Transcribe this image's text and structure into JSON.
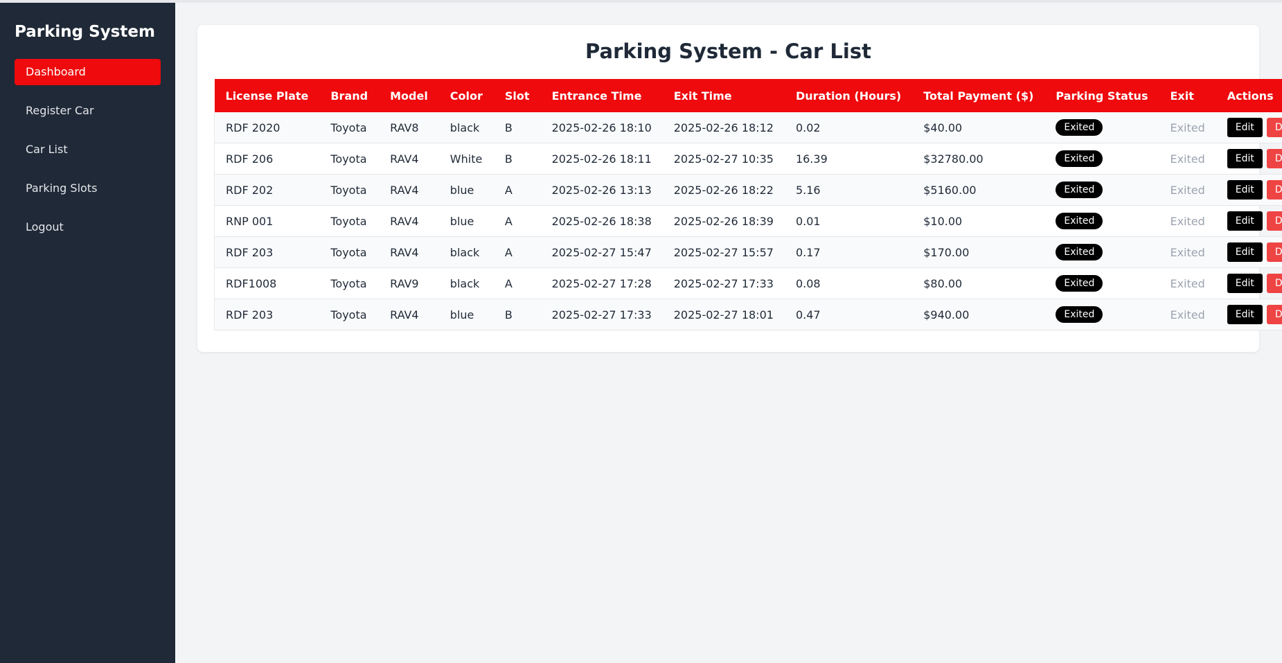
{
  "sidebar": {
    "brand": "Parking System",
    "items": [
      {
        "label": "Dashboard",
        "active": true
      },
      {
        "label": "Register Car"
      },
      {
        "label": "Car List"
      },
      {
        "label": "Parking Slots"
      },
      {
        "label": "Logout"
      }
    ]
  },
  "main": {
    "title": "Parking System - Car List",
    "columns": [
      "License Plate",
      "Brand",
      "Model",
      "Color",
      "Slot",
      "Entrance Time",
      "Exit Time",
      "Duration (Hours)",
      "Total Payment ($)",
      "Parking Status",
      "Exit",
      "Actions"
    ],
    "rows": [
      {
        "plate": "RDF 2020",
        "brand": "Toyota",
        "model": "RAV8",
        "color": "black",
        "slot": "B",
        "entrance": "2025-02-26 18:10",
        "exit_time": "2025-02-26 18:12",
        "duration": "0.02",
        "payment": "$40.00",
        "status": "Exited",
        "exit": "Exited",
        "edit": "Edit",
        "delete": "Delete"
      },
      {
        "plate": "RDF 206",
        "brand": "Toyota",
        "model": "RAV4",
        "color": "White",
        "slot": "B",
        "entrance": "2025-02-26 18:11",
        "exit_time": "2025-02-27 10:35",
        "duration": "16.39",
        "payment": "$32780.00",
        "status": "Exited",
        "exit": "Exited",
        "edit": "Edit",
        "delete": "Delete"
      },
      {
        "plate": "RDF 202",
        "brand": "Toyota",
        "model": "RAV4",
        "color": "blue",
        "slot": "A",
        "entrance": "2025-02-26 13:13",
        "exit_time": "2025-02-26 18:22",
        "duration": "5.16",
        "payment": "$5160.00",
        "status": "Exited",
        "exit": "Exited",
        "edit": "Edit",
        "delete": "Delete"
      },
      {
        "plate": "RNP 001",
        "brand": "Toyota",
        "model": "RAV4",
        "color": "blue",
        "slot": "A",
        "entrance": "2025-02-26 18:38",
        "exit_time": "2025-02-26 18:39",
        "duration": "0.01",
        "payment": "$10.00",
        "status": "Exited",
        "exit": "Exited",
        "edit": "Edit",
        "delete": "Delete"
      },
      {
        "plate": "RDF 203",
        "brand": "Toyota",
        "model": "RAV4",
        "color": "black",
        "slot": "A",
        "entrance": "2025-02-27 15:47",
        "exit_time": "2025-02-27 15:57",
        "duration": "0.17",
        "payment": "$170.00",
        "status": "Exited",
        "exit": "Exited",
        "edit": "Edit",
        "delete": "Delete"
      },
      {
        "plate": "RDF1008",
        "brand": "Toyota",
        "model": "RAV9",
        "color": "black",
        "slot": "A",
        "entrance": "2025-02-27 17:28",
        "exit_time": "2025-02-27 17:33",
        "duration": "0.08",
        "payment": "$80.00",
        "status": "Exited",
        "exit": "Exited",
        "edit": "Edit",
        "delete": "Delete"
      },
      {
        "plate": "RDF 203",
        "brand": "Toyota",
        "model": "RAV4",
        "color": "blue",
        "slot": "B",
        "entrance": "2025-02-27 17:33",
        "exit_time": "2025-02-27 18:01",
        "duration": "0.47",
        "payment": "$940.00",
        "status": "Exited",
        "exit": "Exited",
        "edit": "Edit",
        "delete": "Delete"
      }
    ]
  },
  "colors": {
    "sidebar_bg": "#1f2937",
    "accent_red": "#ee0a0d",
    "delete_red": "#ef4444",
    "badge_black": "#000000",
    "page_bg": "#f3f4f6"
  }
}
